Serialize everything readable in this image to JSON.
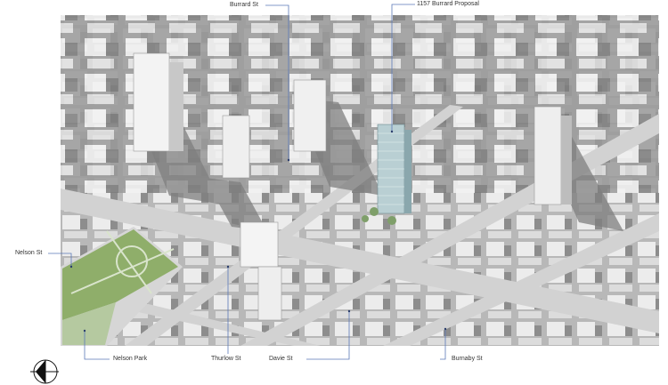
{
  "labels": {
    "burrard_st": "Burrard St",
    "proposal": "1157 Burrard Proposal",
    "nelson_st": "Nelson St",
    "nelson_park": "Nelson Park",
    "thurlow_st": "Thurlow St",
    "davie_st": "Davie St",
    "burnaby_st": "Burnaby St"
  },
  "colors": {
    "leader": "#5b79b8",
    "park": "#8fae6a",
    "road": "#cfcfcf",
    "building": "#e6e6e6",
    "shadow": "#8a8a8a",
    "tower_glass": "#b9cfd3"
  },
  "icons": {
    "north_arrow": "north-arrow-icon"
  }
}
